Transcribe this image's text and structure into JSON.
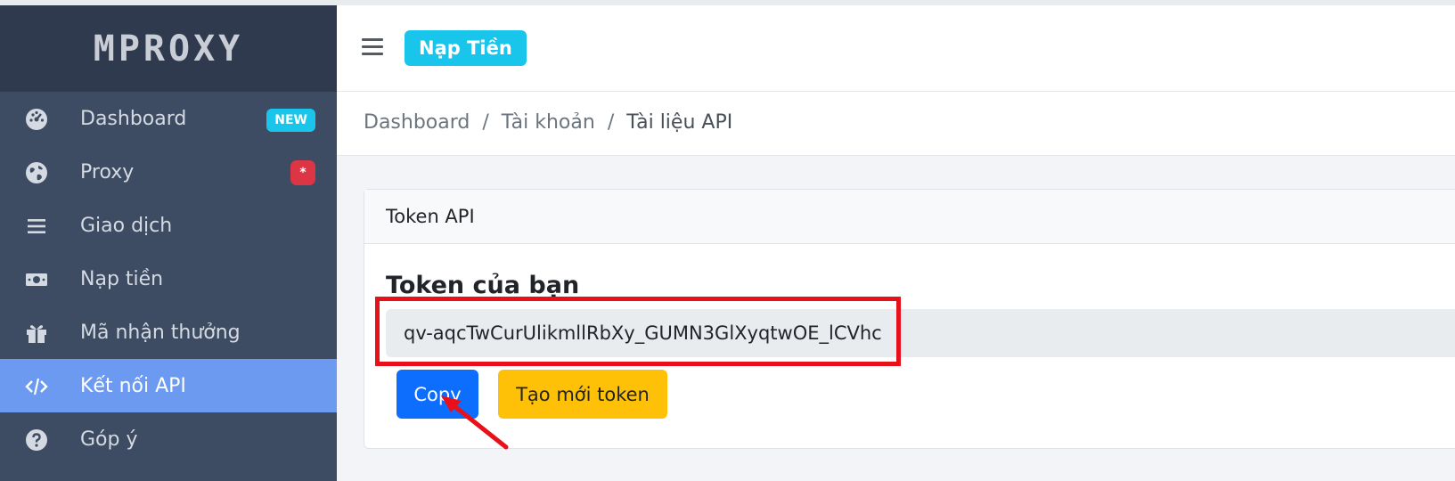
{
  "brand": "MPROXY",
  "sidebar": {
    "items": [
      {
        "label": "Dashboard",
        "badge": "NEW"
      },
      {
        "label": "Proxy",
        "badge": "*"
      },
      {
        "label": "Giao dịch"
      },
      {
        "label": "Nạp tiền"
      },
      {
        "label": "Mã nhận thưởng"
      },
      {
        "label": "Kết nối API"
      },
      {
        "label": "Góp ý"
      }
    ]
  },
  "header": {
    "button_label": "Nạp Tiền"
  },
  "breadcrumb": {
    "items": [
      "Dashboard",
      "Tài khoản",
      "Tài liệu API"
    ],
    "separator": "/"
  },
  "card": {
    "header": "Token API",
    "title": "Token của bạn",
    "token_value": "qv-aqcTwCurUlikmllRbXy_GUMN3GlXyqtwOE_lCVhc",
    "copy_label": "Copy",
    "new_token_label": "Tạo mới token"
  },
  "colors": {
    "sidebar": "#3d4c63",
    "active": "#6b9af0",
    "accent": "#19c5ea",
    "highlight": "#e8101a"
  },
  "icons": [
    "dashboard-icon",
    "globe-icon",
    "list-icon",
    "money-icon",
    "gift-icon",
    "code-icon",
    "question-icon"
  ]
}
